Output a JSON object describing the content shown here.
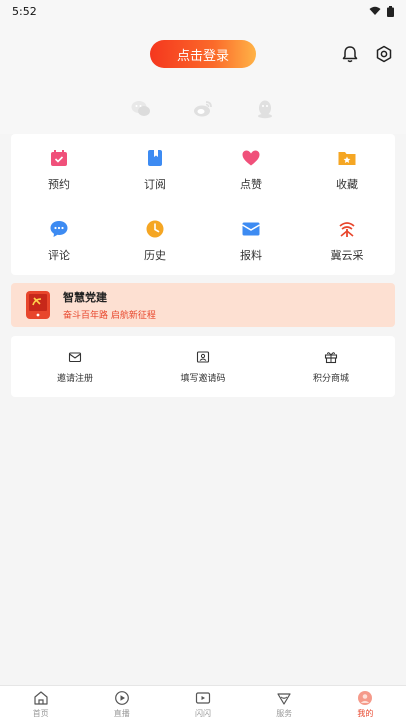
{
  "status": {
    "time": "5:52"
  },
  "header": {
    "login_label": "点击登录"
  },
  "social": [
    "wechat-icon",
    "weibo-icon",
    "qq-icon"
  ],
  "grid": [
    {
      "label": "预约",
      "icon": "calendar-icon",
      "color": "#f0507a"
    },
    {
      "label": "订阅",
      "icon": "book-icon",
      "color": "#3d8bf2"
    },
    {
      "label": "点赞",
      "icon": "heart-icon",
      "color": "#f0507a"
    },
    {
      "label": "收藏",
      "icon": "folder-star-icon",
      "color": "#f5a623"
    },
    {
      "label": "评论",
      "icon": "comment-icon",
      "color": "#3d8bf2"
    },
    {
      "label": "历史",
      "icon": "clock-icon",
      "color": "#f5a623"
    },
    {
      "label": "报料",
      "icon": "mail-icon",
      "color": "#3d8bf2"
    },
    {
      "label": "冀云采",
      "icon": "jiyuncai-icon",
      "color": "#e8462c"
    }
  ],
  "banner": {
    "title": "智慧党建",
    "subtitle": "奋斗百年路 启航新征程"
  },
  "invite": [
    {
      "label": "邀请注册",
      "icon": "envelope-icon"
    },
    {
      "label": "填写邀请码",
      "icon": "id-card-icon"
    },
    {
      "label": "积分商城",
      "icon": "gift-icon"
    }
  ],
  "tabs": [
    {
      "label": "首页",
      "icon": "home-icon"
    },
    {
      "label": "直播",
      "icon": "play-icon"
    },
    {
      "label": "闪闪",
      "icon": "video-icon"
    },
    {
      "label": "服务",
      "icon": "service-icon"
    },
    {
      "label": "我的",
      "icon": "avatar-icon",
      "active": true
    }
  ],
  "colors": {
    "accent": "#e8462c",
    "banner_bg": "#fde0d2"
  }
}
